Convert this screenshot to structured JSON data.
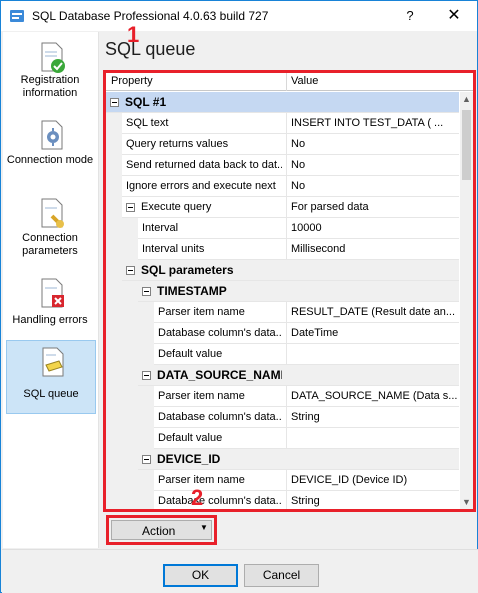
{
  "window": {
    "title": "SQL Database Professional 4.0.63 build 727",
    "help_label": "?",
    "close_label": "✕"
  },
  "sidebar": {
    "items": [
      {
        "label": "Registration information",
        "icon": "registration-check-icon",
        "active": false
      },
      {
        "label": "Connection mode",
        "icon": "gear-document-icon",
        "active": false
      },
      {
        "label": "Connection parameters",
        "icon": "plug-document-icon",
        "active": false
      },
      {
        "label": "Handling errors",
        "icon": "error-document-icon",
        "active": false
      },
      {
        "label": "SQL queue",
        "icon": "sql-queue-icon",
        "active": true
      }
    ]
  },
  "page": {
    "title": "SQL queue"
  },
  "callouts": {
    "one": "1",
    "two": "2"
  },
  "grid": {
    "col_property": "Property",
    "col_value": "Value",
    "rows": [
      {
        "name": "SQL #1",
        "value": "",
        "category": true,
        "selected": true
      },
      {
        "name": "SQL text",
        "value": "INSERT INTO TEST_DATA (  ...",
        "category": false
      },
      {
        "name": "Query returns values",
        "value": "No",
        "category": false
      },
      {
        "name": "Send returned data back to dat...",
        "value": "No",
        "category": false
      },
      {
        "name": "Ignore errors and execute next",
        "value": "No",
        "category": false
      },
      {
        "name": "Execute query",
        "value": "For parsed data",
        "category": false
      },
      {
        "name": "Interval",
        "value": "10000",
        "category": false
      },
      {
        "name": "Interval units",
        "value": "Millisecond",
        "category": false
      },
      {
        "name": "SQL parameters",
        "value": "",
        "category": true
      },
      {
        "name": "TIMESTAMP",
        "value": "",
        "category": true
      },
      {
        "name": "Parser item name",
        "value": "RESULT_DATE (Result date an...",
        "category": false
      },
      {
        "name": "Database column's data...",
        "value": "DateTime",
        "category": false
      },
      {
        "name": "Default value",
        "value": "",
        "category": false
      },
      {
        "name": "DATA_SOURCE_NAME",
        "value": "",
        "category": true
      },
      {
        "name": "Parser item name",
        "value": "DATA_SOURCE_NAME (Data s...",
        "category": false
      },
      {
        "name": "Database column's data...",
        "value": "String",
        "category": false
      },
      {
        "name": "Default value",
        "value": "",
        "category": false
      },
      {
        "name": "DEVICE_ID",
        "value": "",
        "category": true
      },
      {
        "name": "Parser item name",
        "value": "DEVICE_ID (Device ID)",
        "category": false
      },
      {
        "name": "Database column's data...",
        "value": "String",
        "category": false
      }
    ]
  },
  "action": {
    "label": "Action"
  },
  "footer": {
    "ok_label": "OK",
    "cancel_label": "Cancel"
  },
  "colors": {
    "accent": "#1883d7",
    "callout": "#e8202a",
    "selected_row": "#c5d8f2"
  }
}
